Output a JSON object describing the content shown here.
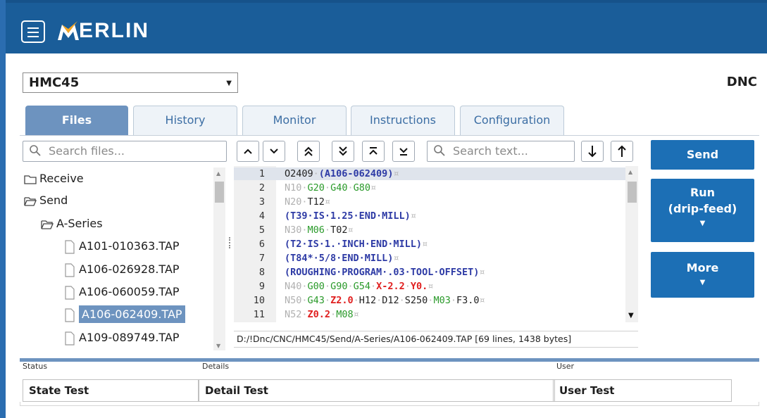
{
  "app": {
    "logo_text": "ERLIN",
    "logo_initial": "M",
    "mode": "DNC"
  },
  "machine": {
    "selected": "HMC45"
  },
  "tabs": [
    {
      "label": "Files",
      "active": true
    },
    {
      "label": "History",
      "active": false
    },
    {
      "label": "Monitor",
      "active": false
    },
    {
      "label": "Instructions",
      "active": false
    },
    {
      "label": "Configuration",
      "active": false
    }
  ],
  "files": {
    "search_placeholder": "Search files...",
    "tree": [
      {
        "label": "Receive",
        "type": "folder"
      },
      {
        "label": "Send",
        "type": "folder-open"
      },
      {
        "label": "A-Series",
        "type": "folder-open"
      },
      {
        "label": "A101-010363.TAP",
        "type": "file"
      },
      {
        "label": "A106-026928.TAP",
        "type": "file"
      },
      {
        "label": "A106-060059.TAP",
        "type": "file"
      },
      {
        "label": "A106-062409.TAP",
        "type": "file",
        "selected": true
      },
      {
        "label": "A109-089749.TAP",
        "type": "file"
      }
    ]
  },
  "editor": {
    "search_placeholder": "Search text...",
    "toolbar_icons": [
      "chevron-up-icon",
      "chevron-down-icon",
      "double-chevron-up-icon",
      "double-chevron-down-icon",
      "jump-top-icon",
      "jump-bottom-icon"
    ],
    "lines": [
      {
        "n": "1",
        "parts": [
          [
            "k",
            "O2409"
          ],
          [
            "d",
            "·"
          ],
          [
            "c",
            "(A106-062409)"
          ],
          [
            "d",
            "¤"
          ]
        ]
      },
      {
        "n": "2",
        "parts": [
          [
            "n",
            "N10"
          ],
          [
            "d",
            "·"
          ],
          [
            "g",
            "G20"
          ],
          [
            "d",
            "·"
          ],
          [
            "g",
            "G40"
          ],
          [
            "d",
            "·"
          ],
          [
            "g",
            "G80"
          ],
          [
            "d",
            "¤"
          ]
        ]
      },
      {
        "n": "3",
        "parts": [
          [
            "n",
            "N20"
          ],
          [
            "d",
            "·"
          ],
          [
            "k",
            "T12"
          ],
          [
            "d",
            "¤"
          ]
        ]
      },
      {
        "n": "4",
        "parts": [
          [
            "c",
            "(T39·IS·1.25·END·MILL)"
          ],
          [
            "d",
            "¤"
          ]
        ]
      },
      {
        "n": "5",
        "parts": [
          [
            "n",
            "N30"
          ],
          [
            "d",
            "·"
          ],
          [
            "g",
            "M06"
          ],
          [
            "d",
            "·"
          ],
          [
            "k",
            "T02"
          ],
          [
            "d",
            "¤"
          ]
        ]
      },
      {
        "n": "6",
        "parts": [
          [
            "c",
            "(T2·IS·1.·INCH·END·MILL)"
          ],
          [
            "d",
            "¤"
          ]
        ]
      },
      {
        "n": "7",
        "parts": [
          [
            "c",
            "(T84*·5/8·END·MILL)"
          ],
          [
            "d",
            "¤"
          ]
        ]
      },
      {
        "n": "8",
        "parts": [
          [
            "c",
            "(ROUGHING·PROGRAM·.03·TOOL·OFFSET)"
          ],
          [
            "d",
            "¤"
          ]
        ]
      },
      {
        "n": "9",
        "parts": [
          [
            "n",
            "N40"
          ],
          [
            "d",
            "·"
          ],
          [
            "g",
            "G00"
          ],
          [
            "d",
            "·"
          ],
          [
            "g",
            "G90"
          ],
          [
            "d",
            "·"
          ],
          [
            "g",
            "G54"
          ],
          [
            "d",
            "·"
          ],
          [
            "r",
            "X-2.2"
          ],
          [
            "d",
            "·"
          ],
          [
            "r",
            "Y0."
          ],
          [
            "d",
            "¤"
          ]
        ]
      },
      {
        "n": "10",
        "parts": [
          [
            "n",
            "N50"
          ],
          [
            "d",
            "·"
          ],
          [
            "g",
            "G43"
          ],
          [
            "d",
            "·"
          ],
          [
            "r",
            "Z2.0"
          ],
          [
            "d",
            "·"
          ],
          [
            "k",
            "H12"
          ],
          [
            "d",
            "·"
          ],
          [
            "k",
            "D12"
          ],
          [
            "d",
            "·"
          ],
          [
            "k",
            "S250"
          ],
          [
            "d",
            "·"
          ],
          [
            "g",
            "M03"
          ],
          [
            "d",
            "·"
          ],
          [
            "k",
            "F3.0"
          ],
          [
            "d",
            "¤"
          ]
        ]
      },
      {
        "n": "11",
        "parts": [
          [
            "n",
            "N52"
          ],
          [
            "d",
            "·"
          ],
          [
            "r",
            "Z0.2"
          ],
          [
            "d",
            "·"
          ],
          [
            "g",
            "M08"
          ],
          [
            "d",
            "¤"
          ]
        ]
      }
    ],
    "path": "D:/!Dnc/CNC/HMC45/Send/A-Series/A106-062409.TAP [69 lines, 1438 bytes]"
  },
  "actions": {
    "send": "Send",
    "run_line1": "Run",
    "run_line2": "(drip-feed)",
    "more": "More"
  },
  "status": {
    "status_label": "Status",
    "status_value": "State Test",
    "details_label": "Details",
    "details_value": "Detail Test",
    "user_label": "User",
    "user_value": "User Test"
  },
  "colors": {
    "header": "#1a5d99",
    "accent": "#6d93bf",
    "button": "#1c6fb5"
  }
}
